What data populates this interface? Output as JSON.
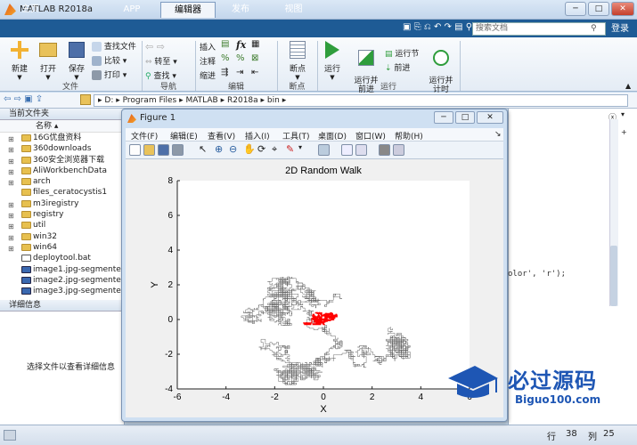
{
  "window": {
    "title": "MATLAB R2018a",
    "minimize": "─",
    "maximize": "□",
    "close": "✕"
  },
  "tabs": [
    {
      "label": "主页",
      "active": false
    },
    {
      "label": "APP",
      "active": false
    },
    {
      "label": "编辑器",
      "active": true
    },
    {
      "label": "发布",
      "active": false
    },
    {
      "label": "视图",
      "active": false
    }
  ],
  "search": {
    "placeholder": "搜索文档"
  },
  "login": "登录",
  "toolstrip": {
    "file": {
      "new": "新建",
      "open": "打开",
      "save": "保存",
      "find_files": "查找文件",
      "compare": "比较",
      "print": "打印",
      "section": "文件"
    },
    "navigate": {
      "goto": "转至",
      "find": "查找",
      "section": "导航"
    },
    "edit": {
      "insert": "插入",
      "comment": "注释",
      "indent": "缩进",
      "fx": "fx",
      "section": "编辑"
    },
    "breakpoints": {
      "label": "断点",
      "section": "断点"
    },
    "run": {
      "run": "运行",
      "run_advance": "运行并\n前进",
      "run_section": "运行节",
      "advance": "前进",
      "run_time": "运行并\n计时",
      "section": "运行"
    }
  },
  "address": {
    "path": [
      "D:",
      "Program Files",
      "MATLAB",
      "R2018a",
      "bin"
    ]
  },
  "left_panel": {
    "header": "当前文件夹",
    "name_col": "名称",
    "items": [
      {
        "name": "16G优盘资料",
        "type": "folder",
        "expand": "⊞"
      },
      {
        "name": "360downloads",
        "type": "folder",
        "expand": "⊞"
      },
      {
        "name": "360安全浏览器下载",
        "type": "folder",
        "expand": "⊞"
      },
      {
        "name": "AliWorkbenchData",
        "type": "folder",
        "expand": "⊞"
      },
      {
        "name": "arch",
        "type": "folder",
        "expand": "⊞"
      },
      {
        "name": "files_ceratocystis1",
        "type": "folder",
        "expand": ""
      },
      {
        "name": "m3iregistry",
        "type": "folder",
        "expand": "⊞"
      },
      {
        "name": "registry",
        "type": "folder",
        "expand": "⊞"
      },
      {
        "name": "util",
        "type": "folder",
        "expand": "⊞"
      },
      {
        "name": "win32",
        "type": "folder",
        "expand": "⊞"
      },
      {
        "name": "win64",
        "type": "folder",
        "expand": "⊞"
      },
      {
        "name": "deploytool.bat",
        "type": "file",
        "expand": ""
      },
      {
        "name": "image1.jpg-segmente...",
        "type": "image",
        "expand": ""
      },
      {
        "name": "image2.jpg-segmente...",
        "type": "image",
        "expand": ""
      },
      {
        "name": "image3.jpg-segmente...",
        "type": "image",
        "expand": ""
      }
    ],
    "details_header": "详细信息",
    "details_text": "选择文件以查看详细信息"
  },
  "editor": {
    "code_fragment": "olor', 'r');"
  },
  "status": {
    "row_label": "行",
    "row": "38",
    "col_label": "列",
    "col": "25"
  },
  "figure": {
    "title": "Figure 1",
    "menu": [
      "文件(F)",
      "编辑(E)",
      "查看(V)",
      "插入(I)",
      "工具(T)",
      "桌面(D)",
      "窗口(W)",
      "帮助(H)"
    ],
    "dock": "↘"
  },
  "chart_data": {
    "type": "line",
    "title": "2D Random Walk",
    "xlabel": "X",
    "ylabel": "Y",
    "xlim": [
      -6,
      6
    ],
    "ylim": [
      -4,
      8
    ],
    "xticks": [
      -6,
      -4,
      -2,
      0,
      2,
      4,
      6
    ],
    "yticks": [
      -4,
      -2,
      0,
      2,
      4,
      6,
      8
    ],
    "grid": false,
    "series": [
      {
        "color": "#666666",
        "extent_x": [
          -5,
          6
        ],
        "extent_y": [
          -3.8,
          6.2
        ]
      },
      {
        "color": "#ff0000",
        "extent_x": [
          -1.1,
          0.6
        ],
        "extent_y": [
          -0.3,
          0.8
        ]
      }
    ]
  },
  "watermark": {
    "text": "必过源码",
    "url": "Biguo100.com"
  }
}
